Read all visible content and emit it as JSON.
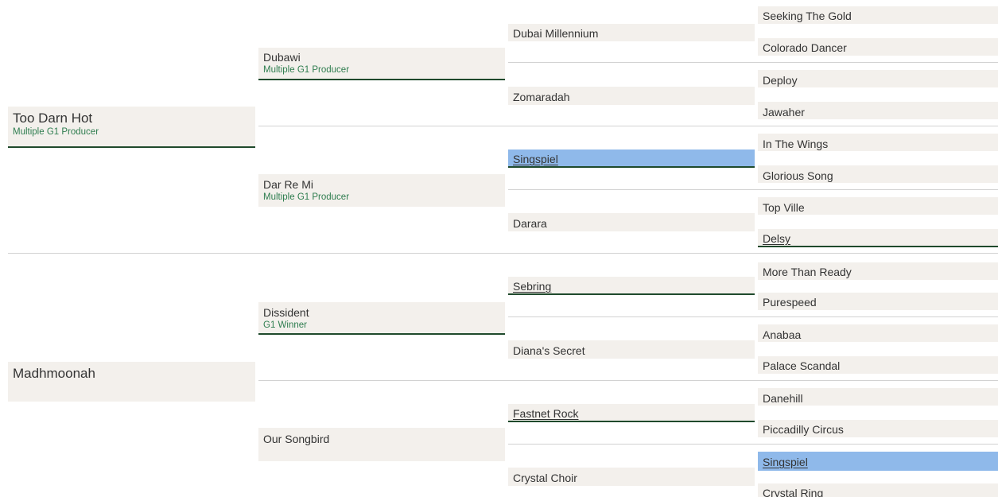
{
  "pedigree": {
    "gen1": [
      {
        "name": "Too Darn Hot",
        "note": "Multiple G1 Producer"
      },
      {
        "name": "Madhmoonah",
        "note": ""
      }
    ],
    "gen2": [
      {
        "name": "Dubawi",
        "note": "Multiple G1 Producer"
      },
      {
        "name": "Dar Re Mi",
        "note": "Multiple G1 Producer"
      },
      {
        "name": "Dissident",
        "note": "G1 Winner"
      },
      {
        "name": "Our Songbird",
        "note": ""
      }
    ],
    "gen3": [
      {
        "name": "Dubai Millennium"
      },
      {
        "name": "Zomaradah"
      },
      {
        "name": "Singspiel"
      },
      {
        "name": "Darara"
      },
      {
        "name": "Sebring"
      },
      {
        "name": "Diana's Secret"
      },
      {
        "name": "Fastnet Rock"
      },
      {
        "name": "Crystal Choir"
      }
    ],
    "gen4": [
      {
        "name": "Seeking The Gold"
      },
      {
        "name": "Colorado Dancer"
      },
      {
        "name": "Deploy"
      },
      {
        "name": "Jawaher"
      },
      {
        "name": "In The Wings"
      },
      {
        "name": "Glorious Song"
      },
      {
        "name": "Top Ville"
      },
      {
        "name": "Delsy"
      },
      {
        "name": "More Than Ready"
      },
      {
        "name": "Purespeed"
      },
      {
        "name": "Anabaa"
      },
      {
        "name": "Palace Scandal"
      },
      {
        "name": "Danehill"
      },
      {
        "name": "Piccadilly Circus"
      },
      {
        "name": "Singspiel"
      },
      {
        "name": "Crystal Ring"
      }
    ]
  },
  "colors": {
    "cell_bg": "#f3f0ec",
    "highlight_bg": "#8fb9ea",
    "note_text": "#2e7d4f",
    "underline": "#1f4a2c",
    "separator": "#d2d2d2"
  }
}
